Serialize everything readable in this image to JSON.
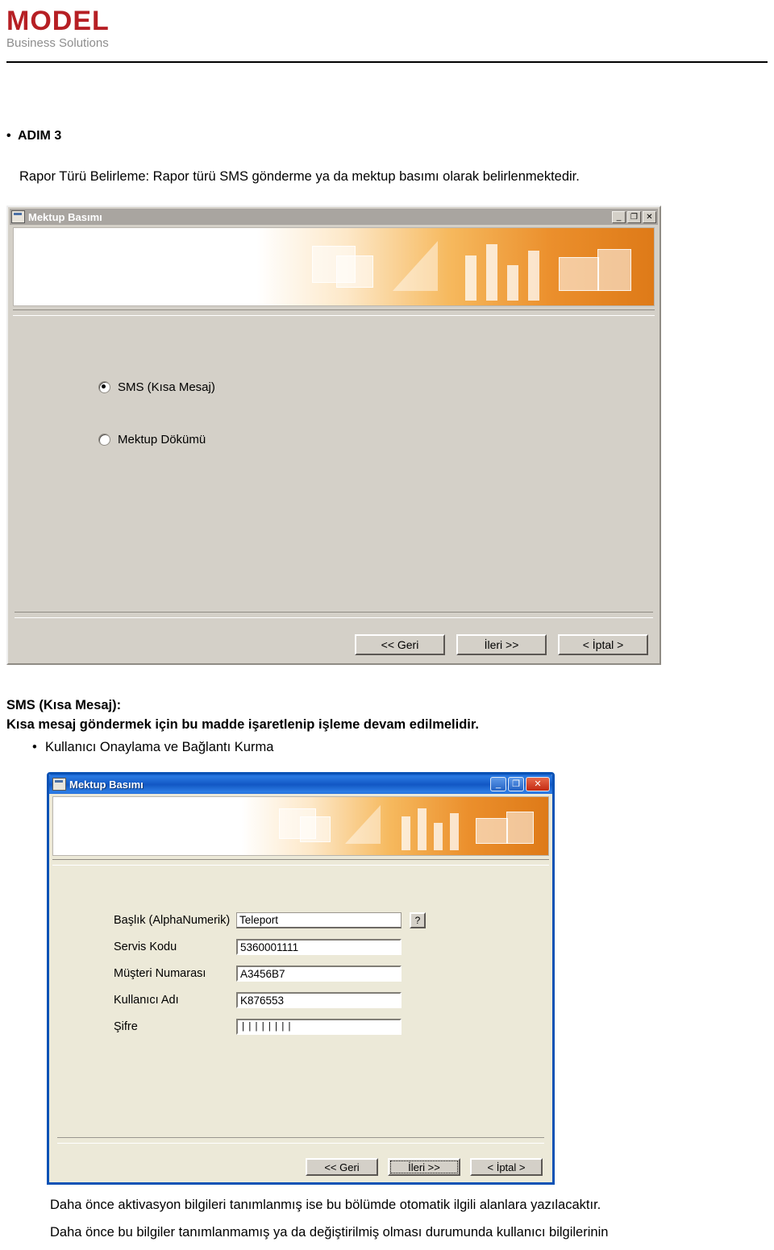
{
  "brand": {
    "name": "MODEL",
    "tagline": "Business Solutions",
    "accent_color": "#b61f24",
    "tagline_color": "#8d8d8d"
  },
  "document": {
    "step_heading": "ADIM 3",
    "step_bullet": "•",
    "intro_paragraph": "Rapor Türü Belirleme: Rapor türü SMS gönderme ya da mektup basımı olarak belirlenmektedir.",
    "sms_heading": "SMS (Kısa Mesaj):",
    "sms_subtext": "Kısa mesaj göndermek için bu madde işaretlenip işleme devam edilmelidir.",
    "sub_bullet": "•",
    "sub_bullet_text": "Kullanıcı Onaylama ve Bağlantı Kurma",
    "footer_line1": "Daha önce aktivasyon bilgileri tanımlanmış ise bu bölümde otomatik ilgili alanlara yazılacaktır.",
    "footer_line2": "Daha önce bu bilgiler tanımlanmamış ya da değiştirilmiş olması durumunda kullanıcı bilgilerinin"
  },
  "dialog1": {
    "title": "Mektup Basımı",
    "window_icon": "window-document-icon",
    "controls": {
      "minimize": "_",
      "maximize": "❐",
      "close": "✕"
    },
    "options": [
      {
        "label": "SMS (Kısa Mesaj)",
        "selected": true
      },
      {
        "label": "Mektup Dökümü",
        "selected": false
      }
    ],
    "buttons": [
      {
        "label": "<< Geri"
      },
      {
        "label": "İleri >>"
      },
      {
        "label": "< İptal >"
      }
    ]
  },
  "dialog2": {
    "title": "Mektup Basımı",
    "window_icon": "window-document-icon",
    "controls": {
      "minimize": "_",
      "maximize": "❐",
      "close": "✕"
    },
    "fields": [
      {
        "label": "Başlık (AlphaNumerik)",
        "value": "Teleport",
        "has_help": true,
        "help_label": "?"
      },
      {
        "label": "Servis Kodu",
        "value": "5360001111",
        "has_help": false
      },
      {
        "label": "Müşteri Numarası",
        "value": "A3456B7",
        "has_help": false
      },
      {
        "label": "Kullanıcı Adı",
        "value": "K876553",
        "has_help": false
      },
      {
        "label": "Şifre",
        "value": "||||||||",
        "has_help": false,
        "masked": true
      }
    ],
    "buttons": [
      {
        "label": "<< Geri"
      },
      {
        "label": "İleri >>"
      },
      {
        "label": "< İptal >"
      }
    ]
  }
}
